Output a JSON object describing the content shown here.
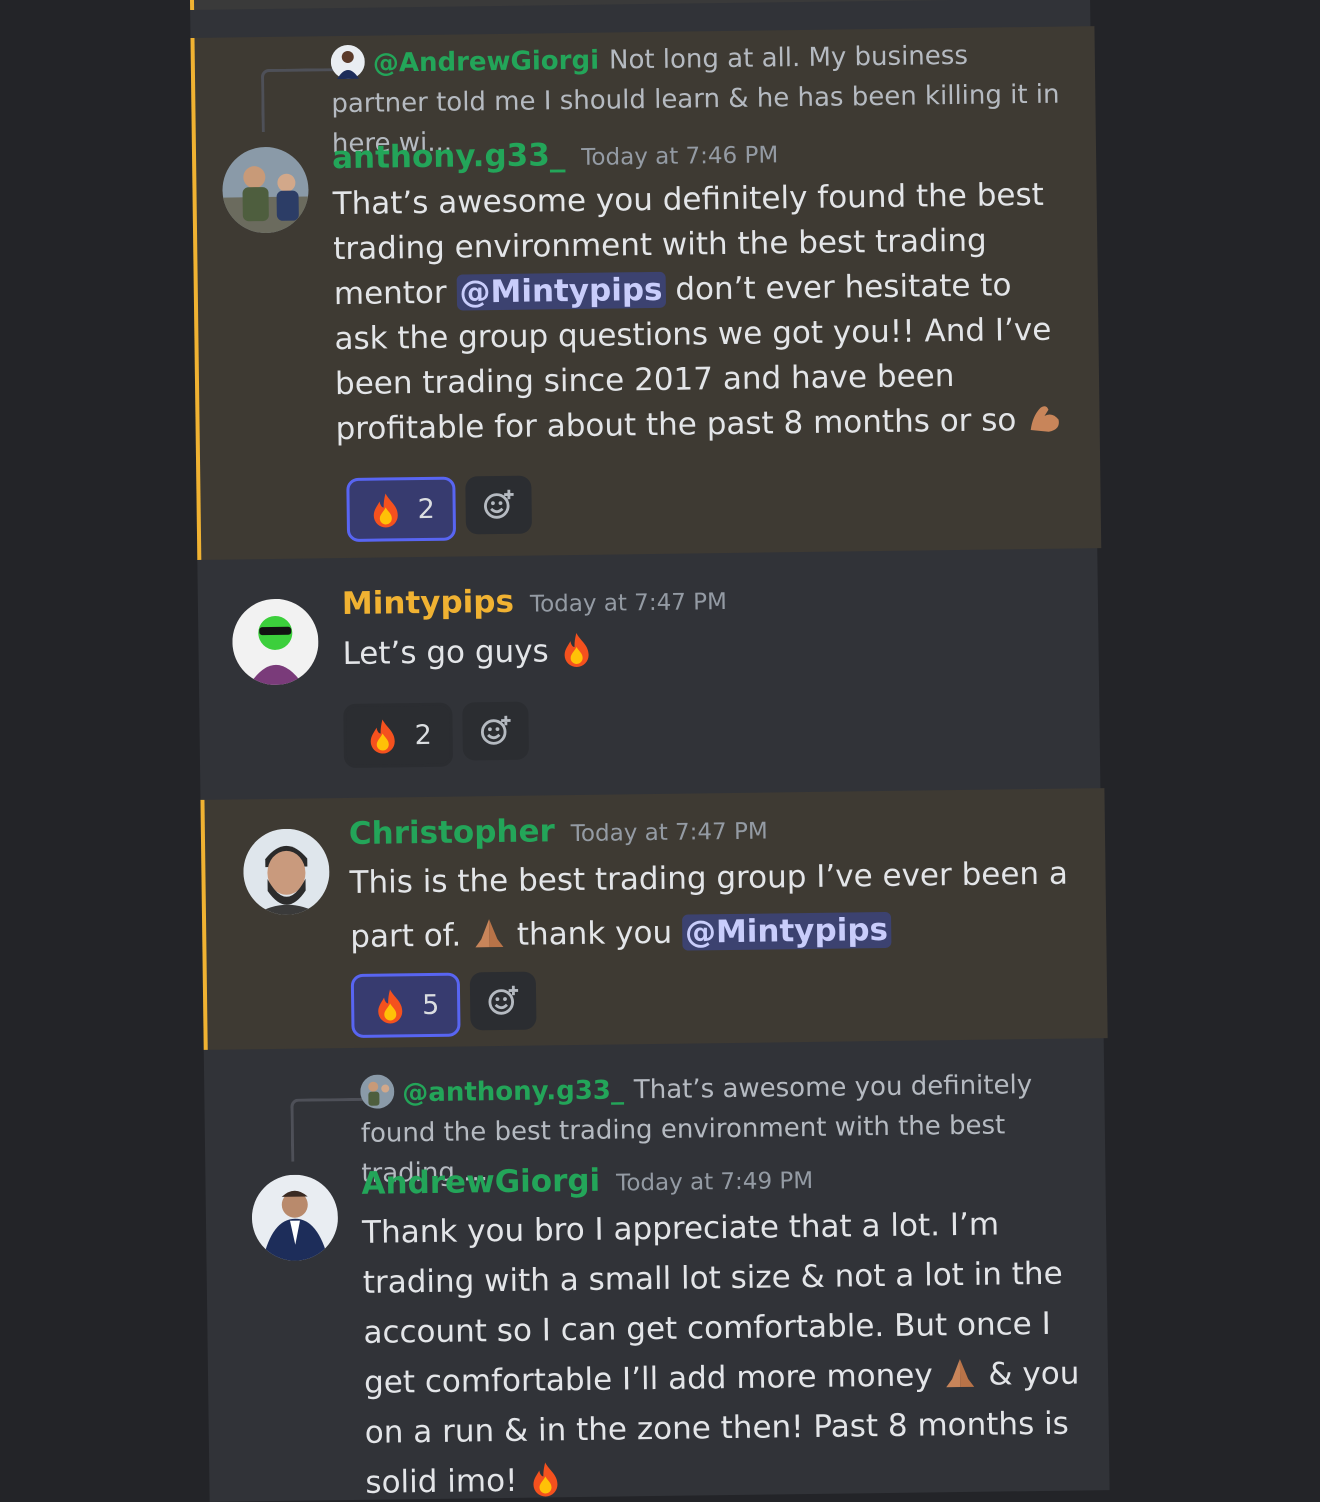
{
  "messages": [
    {
      "reply": {
        "mention": "@AndrewGiorgi",
        "preview": "Not long at all. My business partner told me I should learn & he has been killing it in here wi..."
      },
      "author": "anthony.g33_",
      "author_color": "#23a559",
      "timestamp": "Today at 7:46 PM",
      "text_parts": {
        "p1": "That’s awesome you definitely found the best trading environment with the best trading mentor ",
        "mention": "@Mintypips",
        "p2": " don’t ever hesitate to ask the group questions we got you!! And I’ve been trading since 2017 and have been profitable for about the past 8 months or so "
      },
      "emoji": "flexed-biceps",
      "reaction": {
        "emoji": "fire",
        "count": "2",
        "active": true
      }
    },
    {
      "author": "Mintypips",
      "author_color": "#f0b232",
      "timestamp": "Today at 7:47 PM",
      "text": "Let’s go guys ",
      "emoji": "fire",
      "reaction": {
        "emoji": "fire",
        "count": "2",
        "active": false
      }
    },
    {
      "author": "Christopher",
      "author_color": "#23a559",
      "timestamp": "Today at 7:47 PM",
      "text_parts": {
        "p1": "This is the best trading group I’ve ever been a part of. ",
        "p2": " thank you ",
        "mention": "@Mintypips"
      },
      "emoji": "folded-hands",
      "reaction": {
        "emoji": "fire",
        "count": "5",
        "active": true
      }
    },
    {
      "reply": {
        "mention": "@anthony.g33_",
        "preview": "That’s awesome you definitely found the best trading environment with the best trading ..."
      },
      "author": "AndrewGiorgi",
      "author_color": "#23a559",
      "timestamp": "Today at 7:49 PM",
      "text_parts": {
        "p1": "Thank you bro I appreciate that a lot. I’m trading with a small lot size & not a lot in the account so I can get comfortable. But once I get comfortable I’ll add more money ",
        "p2": " & you on a run & in the zone then! Past 8 months is solid imo! "
      },
      "emoji": "folded-hands",
      "emoji_end": "fire"
    }
  ],
  "icons": {
    "add_reaction": "add-reaction-icon"
  },
  "colors": {
    "mention_bg": "#3c4270",
    "highlight_bar": "#f0b232"
  }
}
